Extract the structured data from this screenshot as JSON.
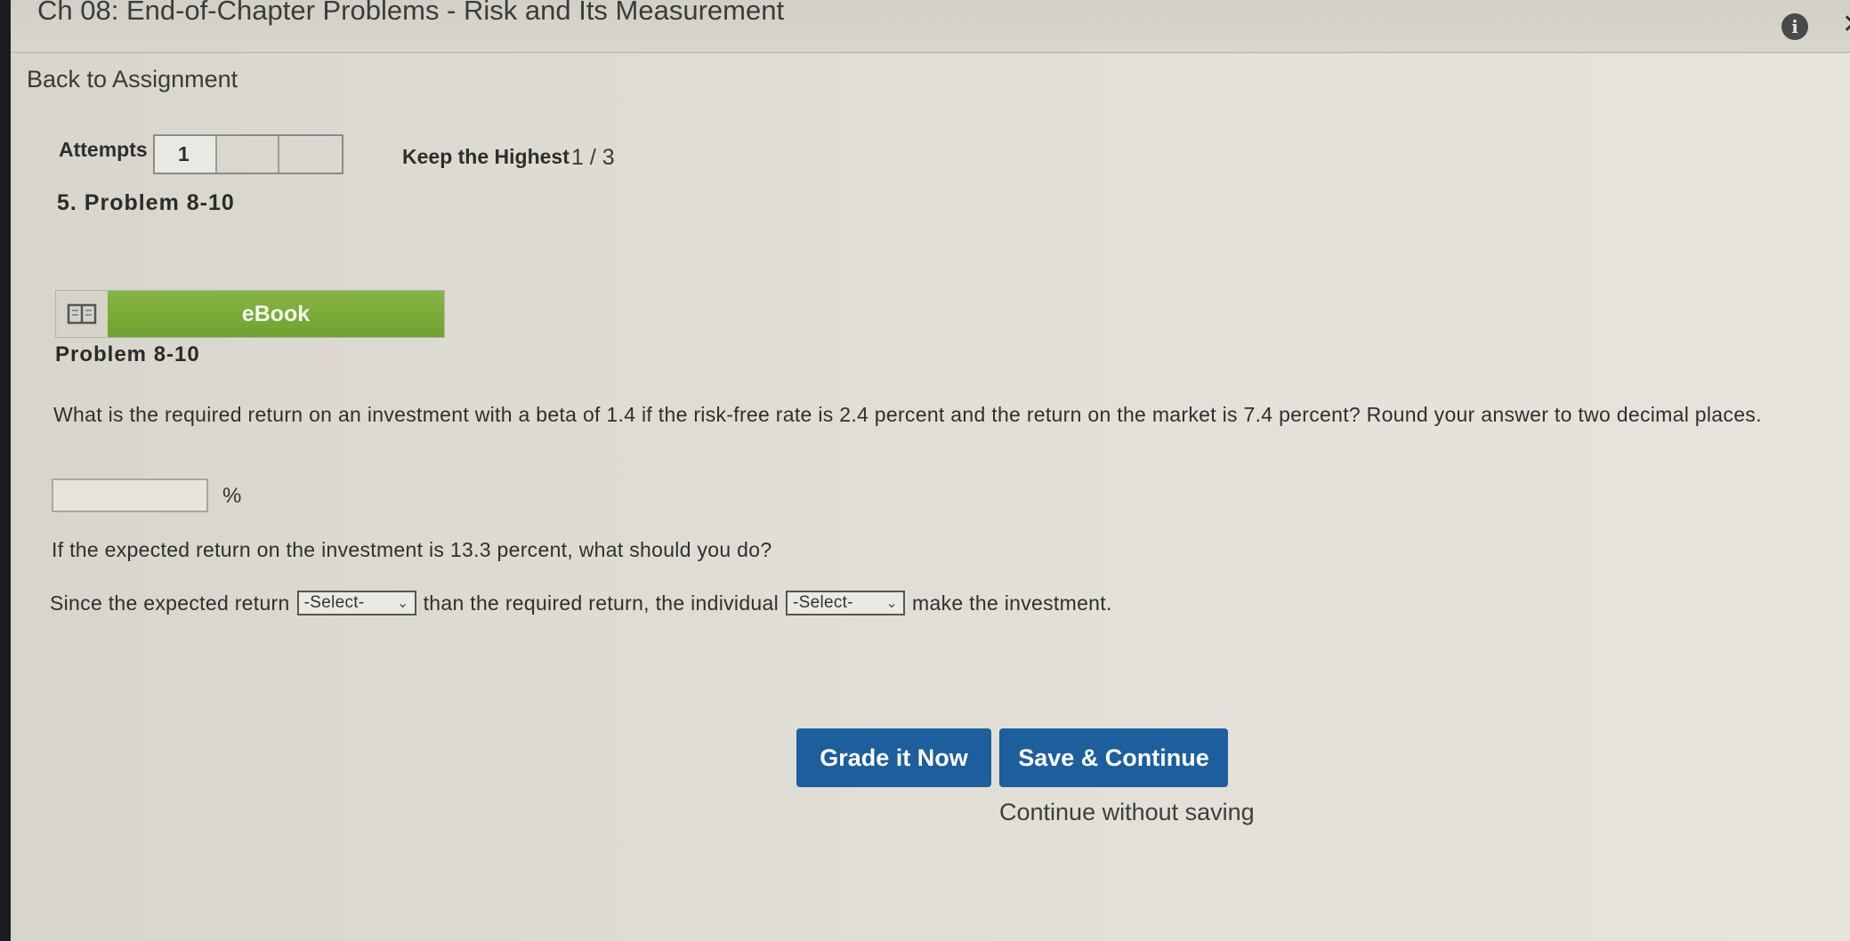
{
  "header": {
    "title": "Ch 08: End-of-Chapter Problems - Risk and Its Measurement",
    "info_icon": "info-icon",
    "close_icon": "close-icon"
  },
  "nav": {
    "back_link": "Back to Assignment"
  },
  "attempts": {
    "label": "Attempts",
    "boxes": [
      "1",
      "",
      ""
    ],
    "keep_label": "Keep the Highest",
    "keep_count": "1 / 3"
  },
  "problem": {
    "heading": "5.  Problem 8-10",
    "ebook_label": "eBook",
    "ebook_icon": "book-icon",
    "title": "Problem 8-10",
    "question": "What is the required return on an investment with a beta of 1.4 if the risk-free rate is 2.4 percent and the return on the market is 7.4 percent? Round your answer to two decimal places.",
    "answer_value": "",
    "unit": "%",
    "question2": "If the expected return on the investment is 13.3 percent, what should you do?",
    "sentence_part1": "Since the expected return",
    "select1": "-Select-",
    "sentence_part2": "than the required return, the individual",
    "select2": "-Select-",
    "sentence_part3": "make the investment."
  },
  "actions": {
    "grade": "Grade it Now",
    "save": "Save & Continue",
    "continue": "Continue without saving"
  },
  "colors": {
    "accent_blue": "#1d5e9c",
    "ebook_green": "#78ab38",
    "background": "#dedbd2"
  }
}
